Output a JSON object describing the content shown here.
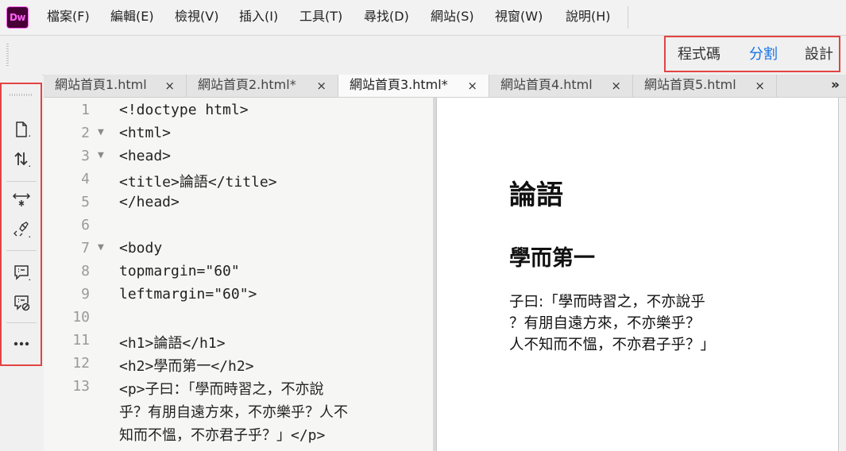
{
  "app": {
    "logo_text": "Dw"
  },
  "menu": [
    "檔案(F)",
    "編輯(E)",
    "檢視(V)",
    "插入(I)",
    "工具(T)",
    "尋找(D)",
    "網站(S)",
    "視窗(W)",
    "說明(H)"
  ],
  "view_switch": {
    "code": "程式碼",
    "split": "分割",
    "design": "設計",
    "active": "split"
  },
  "tabs": [
    {
      "label": "網站首頁1.html",
      "close": "×"
    },
    {
      "label": "網站首頁2.html*",
      "close": "×"
    },
    {
      "label": "網站首頁3.html*",
      "close": "×",
      "active": true
    },
    {
      "label": "網站首頁4.html",
      "close": "×"
    },
    {
      "label": "網站首頁5.html",
      "close": "×"
    }
  ],
  "tab_overflow": "»",
  "sidebar_tools": [
    "new-document-icon",
    "sort-icon",
    "expand-collapse-icon",
    "format-source-icon",
    "apply-comment-icon",
    "remove-comment-icon",
    "more-icon"
  ],
  "code_lines": [
    {
      "num": "1",
      "fold": "",
      "text": "<!doctype html>"
    },
    {
      "num": "2",
      "fold": "▼",
      "text": "<html>"
    },
    {
      "num": "3",
      "fold": "▼",
      "text": "<head>"
    },
    {
      "num": "4",
      "fold": "",
      "text": "<title>論語</title>"
    },
    {
      "num": "5",
      "fold": "",
      "text": "</head>"
    },
    {
      "num": "6",
      "fold": "",
      "text": ""
    },
    {
      "num": "7",
      "fold": "▼",
      "text": "<body"
    },
    {
      "num": "8",
      "fold": "",
      "text": "topmargin=\"60\""
    },
    {
      "num": "9",
      "fold": "",
      "text": "leftmargin=\"60\">"
    },
    {
      "num": "10",
      "fold": "",
      "text": ""
    },
    {
      "num": "11",
      "fold": "",
      "text": "<h1>論語</h1>"
    },
    {
      "num": "12",
      "fold": "",
      "text": "<h2>學而第一</h2>"
    },
    {
      "num": "13",
      "fold": "",
      "text": "<p>子曰：「學而時習之，不亦說"
    }
  ],
  "code_wrap": [
    "乎？有朋自遠方來，不亦樂乎？人不",
    "知而不慍，不亦君子乎？」</p>"
  ],
  "design_view": {
    "h1": "論語",
    "h2": "學而第一",
    "p_lines": [
      "子曰:「學而時習之，不亦說乎",
      "？有朋自遠方來，不亦樂乎？",
      "人不知而不慍，不亦君子乎？」"
    ]
  }
}
